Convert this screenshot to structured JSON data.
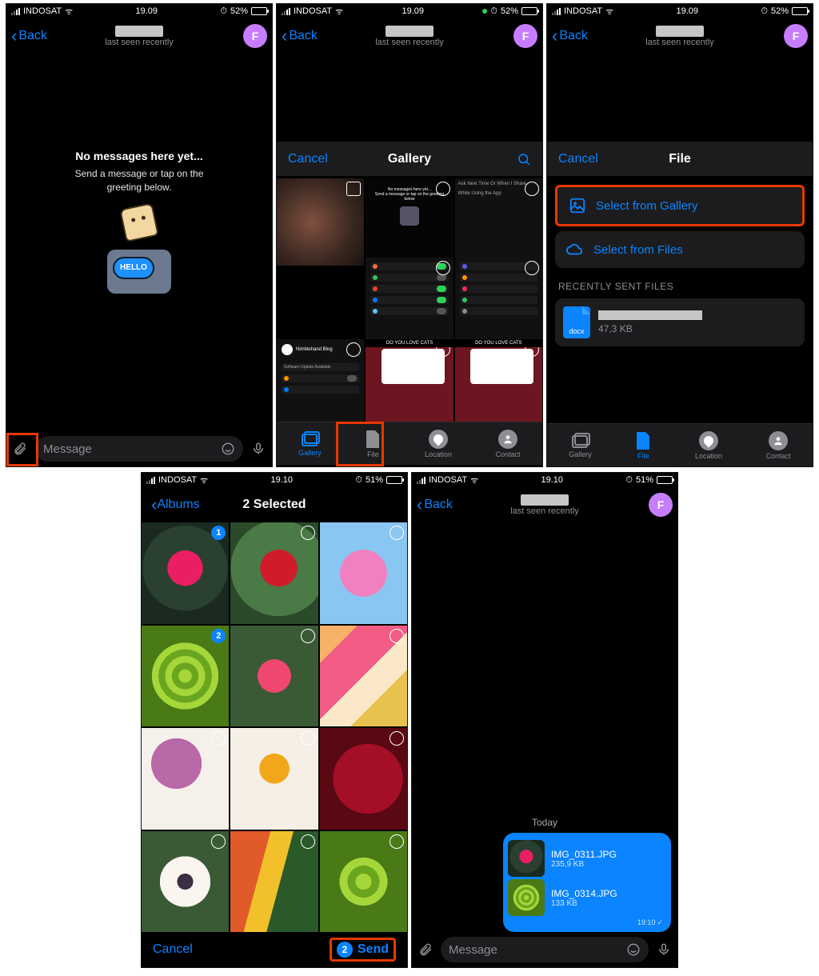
{
  "status": {
    "carrier": "INDOSAT",
    "time_a": "19.09",
    "time_b": "19.10",
    "batt_a": "52%",
    "batt_b": "51%",
    "lock_icon": "⏱"
  },
  "nav": {
    "back": "Back",
    "subtitle": "last seen recently",
    "avatar_letter": "F"
  },
  "empty": {
    "title": "No messages here yet...",
    "sub": "Send a message or tap on the\ngreeting below.",
    "hello": "HELLO"
  },
  "input": {
    "placeholder": "Message"
  },
  "picker": {
    "cancel": "Cancel",
    "title_gallery": "Gallery",
    "title_file": "File",
    "tabs": {
      "gallery": "Gallery",
      "file": "File",
      "location": "Location",
      "contact": "Contact"
    },
    "cell_banner": "DO YOU LOVE CATS"
  },
  "file": {
    "opt_gallery": "Select from Gallery",
    "opt_files": "Select from Files",
    "recent_header": "RECENTLY SENT FILES",
    "docx": "docx",
    "size": "47,3 KB"
  },
  "albums": {
    "back": "Albums",
    "title": "2 Selected",
    "cancel": "Cancel",
    "send": "Send",
    "count": "2",
    "sel1": "1",
    "sel2": "2"
  },
  "chat": {
    "today": "Today",
    "att1": {
      "name": "IMG_0311.JPG",
      "size": "235,9 KB"
    },
    "att2": {
      "name": "IMG_0314.JPG",
      "size": "133 KB"
    },
    "time": "19:10",
    "tick": "✓"
  }
}
